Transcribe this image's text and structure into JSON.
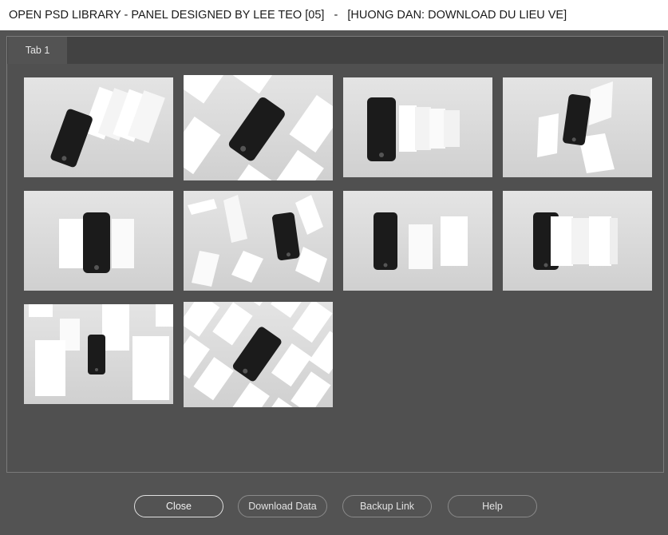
{
  "window": {
    "title": "OPEN PSD LIBRARY - PANEL DESIGNED BY LEE TEO [05]   -   [HUONG DAN: DOWNLOAD DU LIEU VE]"
  },
  "tabs": [
    {
      "label": "Tab 1",
      "active": true
    }
  ],
  "gallery": {
    "item_count": 10,
    "items": [
      {
        "name": "phone-mockup-1",
        "style": "tilted phone with standing cards"
      },
      {
        "name": "phone-mockup-2",
        "style": "phone among diagonal cards"
      },
      {
        "name": "phone-mockup-3",
        "style": "phone with card row"
      },
      {
        "name": "phone-mockup-4",
        "style": "tilted phone with floating cards"
      },
      {
        "name": "phone-mockup-5",
        "style": "phone between two cards"
      },
      {
        "name": "phone-mockup-6",
        "style": "phone with falling cards"
      },
      {
        "name": "phone-mockup-7",
        "style": "phone with two cards"
      },
      {
        "name": "phone-mockup-8",
        "style": "phone with card stack"
      },
      {
        "name": "phone-mockup-9",
        "style": "phone with floating rectangles"
      },
      {
        "name": "phone-mockup-10",
        "style": "phone among tiled cards"
      }
    ]
  },
  "buttons": {
    "close": "Close",
    "download": "Download Data",
    "backup": "Backup Link",
    "help": "Help"
  },
  "colors": {
    "background": "#535353",
    "titlebar": "#ffffff",
    "tabstrip": "#424242",
    "button_border": "#8a8a8a"
  }
}
